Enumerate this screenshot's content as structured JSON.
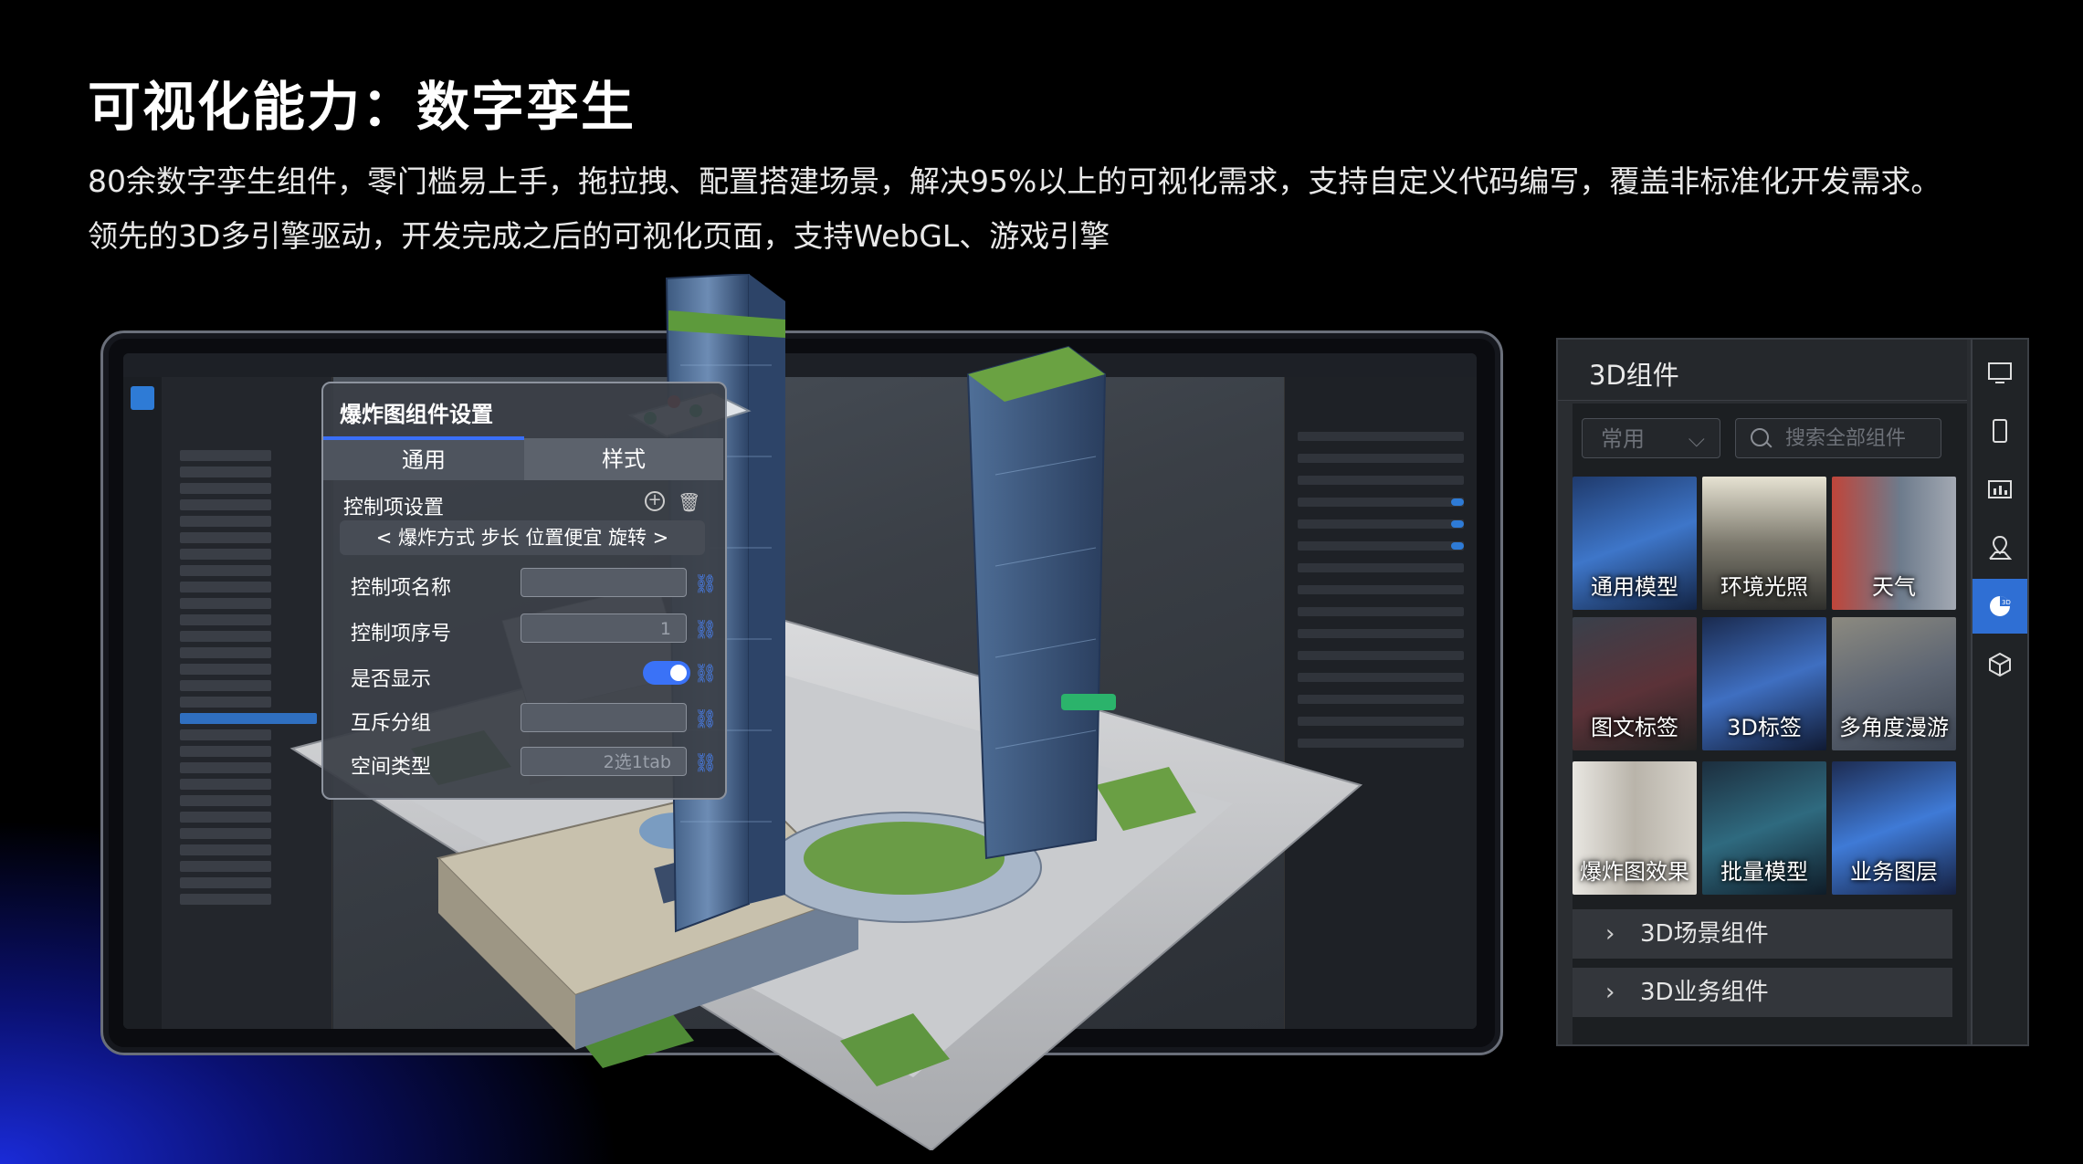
{
  "header": {
    "title": "可视化能力：数字孪生",
    "line1": "80余数字孪生组件，零门槛易上手，拖拉拽、配置搭建场景，解决95%以上的可视化需求，支持自定义代码编写，覆盖非标准化开发需求。",
    "line2": "领先的3D多引擎驱动，开发完成之后的可视化页面，支持WebGL、游戏引擎"
  },
  "explosion_panel": {
    "title": "爆炸图组件设置",
    "tabs": [
      "通用",
      "样式"
    ],
    "control_settings_label": "控制项设置",
    "control_bar": "<  爆炸方式  步长  位置便宜  旋转  >",
    "fields": [
      {
        "label": "控制项名称",
        "value": ""
      },
      {
        "label": "控制项序号",
        "value": "1"
      },
      {
        "label": "是否显示",
        "value": "on"
      },
      {
        "label": "互斥分组",
        "value": ""
      },
      {
        "label": "空间类型",
        "value": "2选1tab"
      }
    ]
  },
  "component_panel": {
    "title": "3D组件",
    "category_select": "常用",
    "search_placeholder": "搜索全部组件",
    "tiles": [
      "通用模型",
      "环境光照",
      "天气",
      "图文标签",
      "3D标签",
      "多角度漫游",
      "爆炸图效果",
      "批量模型",
      "业务图层"
    ],
    "accordions": [
      "3D场景组件",
      "3D业务组件"
    ],
    "rail_icons": [
      "screen-icon",
      "mobile-icon",
      "chart-icon",
      "map-pin-icon",
      "3d-chart-icon",
      "cube-icon"
    ],
    "selected_rail": "3d-chart-icon"
  },
  "colors": {
    "accent": "#3a6ff7",
    "panel_bg": "#2a2d31",
    "rail_selected": "#2f6fd4"
  }
}
